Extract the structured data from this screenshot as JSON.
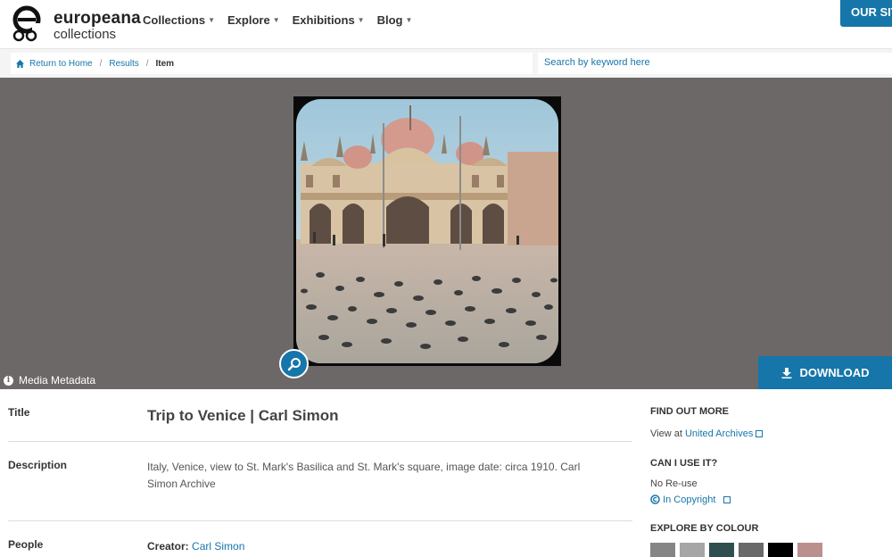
{
  "header": {
    "logo_word": "europeana",
    "logo_sub": "collections",
    "nav": [
      "Collections",
      "Explore",
      "Exhibitions",
      "Blog"
    ],
    "our_sites": "OUR SITES"
  },
  "breadcrumb": {
    "home": "Return to Home",
    "results": "Results",
    "current": "Item",
    "separator": "/"
  },
  "search": {
    "placeholder": "Search by keyword here"
  },
  "media": {
    "metadata_label": "Media Metadata",
    "info_icon": "i",
    "download_label": "DOWNLOAD"
  },
  "item": {
    "title_label": "Title",
    "title_value": "Trip to Venice | Carl Simon",
    "description_label": "Description",
    "description_value": "Italy, Venice, view to St. Mark's Basilica and St. Mark's square, image date: circa 1910. Carl Simon Archive",
    "people_label": "People",
    "creator_label": "Creator:",
    "creator_value": "Carl Simon"
  },
  "side": {
    "find_out_more": "FIND OUT MORE",
    "view_at": "View at",
    "provider": "United Archives",
    "can_i_use": "CAN I USE IT?",
    "no_reuse": "No Re-use",
    "rights": "In Copyright",
    "explore_colour": "EXPLORE BY COLOUR",
    "colours": [
      "#858585",
      "#a6a6a6",
      "#2f4f4f",
      "#696969",
      "#000000",
      "#bc8f8f"
    ]
  }
}
